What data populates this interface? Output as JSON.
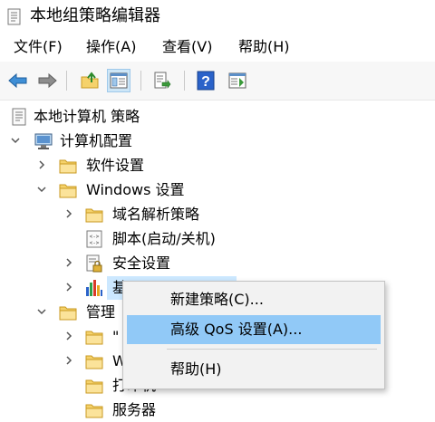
{
  "window": {
    "title": "本地组策略编辑器"
  },
  "menu": {
    "items": [
      {
        "label": "文件(F)"
      },
      {
        "label": "操作(A)"
      },
      {
        "label": "查看(V)"
      },
      {
        "label": "帮助(H)"
      }
    ]
  },
  "toolbar": {
    "buttons": [
      {
        "icon": "back-arrow-icon"
      },
      {
        "icon": "forward-arrow-icon"
      },
      {
        "icon": "up-folder-icon"
      },
      {
        "icon": "show-hide-tree-icon",
        "active": true
      },
      {
        "icon": "export-list-icon"
      },
      {
        "icon": "help-icon"
      },
      {
        "icon": "show-action-pane-icon"
      }
    ]
  },
  "tree": {
    "root": "本地计算机 策略",
    "computer_config": "计算机配置",
    "software_settings": "软件设置",
    "windows_settings": "Windows 设置",
    "name_resolution": "域名解析策略",
    "scripts": "脚本(启动/关机)",
    "security_settings": "安全设置",
    "qos_partial": "基",
    "admin_templates_partial": "管理",
    "child1_partial": "\"",
    "child2_partial": "W",
    "printers_partial": "打印机",
    "server": "服务器"
  },
  "context_menu": {
    "items": [
      {
        "label": "新建策略(C)..."
      },
      {
        "label": "高级 QoS 设置(A)...",
        "highlighted": true
      },
      {
        "label": "帮助(H)"
      }
    ]
  },
  "colors": {
    "folder": "#f5d26b",
    "folder_dark": "#d9aa2f",
    "selection": "#cce8ff",
    "menu_highlight": "#91c9f7"
  }
}
